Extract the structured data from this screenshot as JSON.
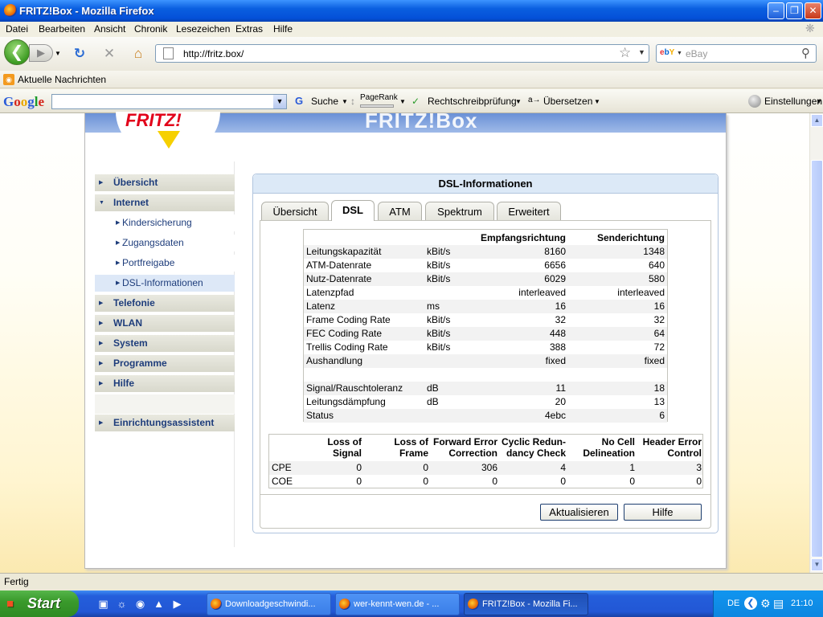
{
  "window": {
    "title": "FRITZ!Box - Mozilla Firefox"
  },
  "menu": [
    "Datei",
    "Bearbeiten",
    "Ansicht",
    "Chronik",
    "Lesezeichen",
    "Extras",
    "Hilfe"
  ],
  "nav": {
    "url": "http://fritz.box/",
    "search_engine": "eBay",
    "search_placeholder": "eBay"
  },
  "bookmarks": {
    "item": "Aktuelle Nachrichten"
  },
  "googlebar": {
    "logo": "Google",
    "search": "Suche",
    "pagerank": "PageRank",
    "spell": "Rechtschreibprüfung",
    "translate": "Übersetzen",
    "settings": "Einstellungen"
  },
  "fritz": {
    "header": "FRITZ!Box",
    "logo": "FRITZ!"
  },
  "sidebar": {
    "items": [
      {
        "label": "Übersicht",
        "level": 0
      },
      {
        "label": "Internet",
        "level": 0
      },
      {
        "label": "Kindersicherung",
        "level": 1
      },
      {
        "label": "Zugangsdaten",
        "level": 1
      },
      {
        "label": "Portfreigabe",
        "level": 1
      },
      {
        "label": "DSL-Informationen",
        "level": 1
      },
      {
        "label": "Telefonie",
        "level": 0
      },
      {
        "label": "WLAN",
        "level": 0
      },
      {
        "label": "System",
        "level": 0
      },
      {
        "label": "Programme",
        "level": 0
      },
      {
        "label": "Hilfe",
        "level": 0
      }
    ],
    "assistant": "Einrichtungsassistent"
  },
  "panel": {
    "title": "DSL-Informationen",
    "tabs": [
      "Übersicht",
      "DSL",
      "ATM",
      "Spektrum",
      "Erweitert"
    ],
    "active_tab": "DSL"
  },
  "dsl": {
    "headers": [
      "",
      "",
      "Empfangsrichtung",
      "Senderichtung"
    ],
    "rows": [
      [
        "Leitungskapazität",
        "kBit/s",
        "8160",
        "1348"
      ],
      [
        "ATM-Datenrate",
        "kBit/s",
        "6656",
        "640"
      ],
      [
        "Nutz-Datenrate",
        "kBit/s",
        "6029",
        "580"
      ],
      [
        "Latenzpfad",
        "",
        "interleaved",
        "interleaved"
      ],
      [
        "Latenz",
        "ms",
        "16",
        "16"
      ],
      [
        "Frame Coding Rate",
        "kBit/s",
        "32",
        "32"
      ],
      [
        "FEC Coding Rate",
        "kBit/s",
        "448",
        "64"
      ],
      [
        "Trellis Coding Rate",
        "kBit/s",
        "388",
        "72"
      ],
      [
        "Aushandlung",
        "",
        "fixed",
        "fixed"
      ],
      [
        "",
        "",
        "",
        ""
      ],
      [
        "Signal/Rauschtoleranz",
        "dB",
        "11",
        "18"
      ],
      [
        "Leitungsdämpfung",
        "dB",
        "20",
        "13"
      ],
      [
        "Status",
        "",
        "4ebc",
        "6"
      ]
    ]
  },
  "errors": {
    "headers": [
      [
        "Loss of",
        "Signal"
      ],
      [
        "Loss of",
        "Frame"
      ],
      [
        "Forward Error",
        "Correction"
      ],
      [
        "Cyclic Redun-",
        "dancy Check"
      ],
      [
        "No Cell",
        "Delineation"
      ],
      [
        "Header Error",
        "Control"
      ]
    ],
    "rows": [
      [
        "CPE",
        "0",
        "0",
        "306",
        "4",
        "1",
        "3"
      ],
      [
        "COE",
        "0",
        "0",
        "0",
        "0",
        "0",
        "0"
      ]
    ]
  },
  "buttons": {
    "refresh": "Aktualisieren",
    "help": "Hilfe"
  },
  "status": "Fertig",
  "taskbar": {
    "start": "Start",
    "tasks": [
      "Downloadgeschwindi...",
      "wer-kennt-wen.de - ...",
      "FRITZ!Box - Mozilla Fi..."
    ],
    "lang": "DE",
    "time": "21:10"
  }
}
